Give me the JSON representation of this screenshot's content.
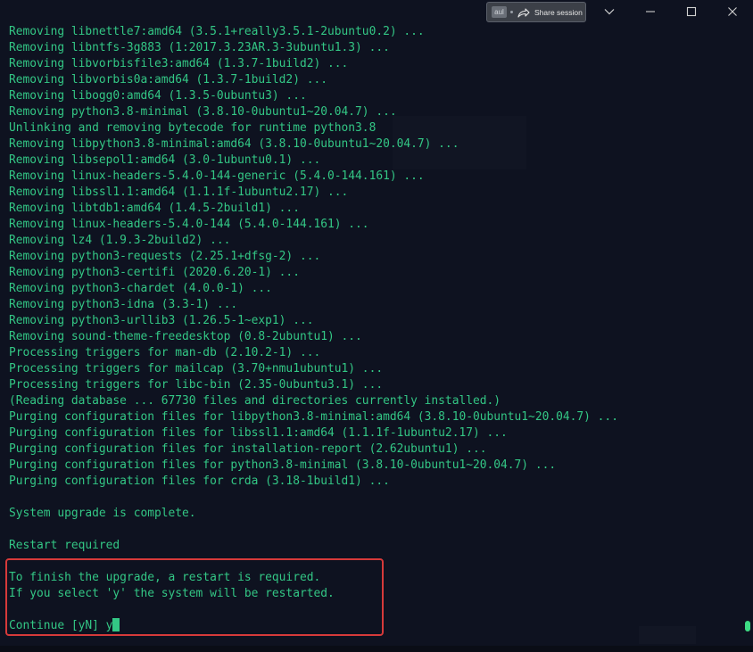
{
  "titlebar": {
    "share_badge": "aul",
    "share_label": "Share session",
    "icons": [
      "share-icon",
      "chevron-down-icon",
      "minimize-icon",
      "maximize-icon",
      "close-icon"
    ]
  },
  "colors": {
    "terminal_text": "#33c785",
    "background": "#0e1220",
    "highlight_border": "#d63a3a"
  },
  "terminal": {
    "lines": [
      "Removing libnettle7:amd64 (3.5.1+really3.5.1-2ubuntu0.2) ...",
      "Removing libntfs-3g883 (1:2017.3.23AR.3-3ubuntu1.3) ...",
      "Removing libvorbisfile3:amd64 (1.3.7-1build2) ...",
      "Removing libvorbis0a:amd64 (1.3.7-1build2) ...",
      "Removing libogg0:amd64 (1.3.5-0ubuntu3) ...",
      "Removing python3.8-minimal (3.8.10-0ubuntu1~20.04.7) ...",
      "Unlinking and removing bytecode for runtime python3.8",
      "Removing libpython3.8-minimal:amd64 (3.8.10-0ubuntu1~20.04.7) ...",
      "Removing libsepol1:amd64 (3.0-1ubuntu0.1) ...",
      "Removing linux-headers-5.4.0-144-generic (5.4.0-144.161) ...",
      "Removing libssl1.1:amd64 (1.1.1f-1ubuntu2.17) ...",
      "Removing libtdb1:amd64 (1.4.5-2build1) ...",
      "Removing linux-headers-5.4.0-144 (5.4.0-144.161) ...",
      "Removing lz4 (1.9.3-2build2) ...",
      "Removing python3-requests (2.25.1+dfsg-2) ...",
      "Removing python3-certifi (2020.6.20-1) ...",
      "Removing python3-chardet (4.0.0-1) ...",
      "Removing python3-idna (3.3-1) ...",
      "Removing python3-urllib3 (1.26.5-1~exp1) ...",
      "Removing sound-theme-freedesktop (0.8-2ubuntu1) ...",
      "Processing triggers for man-db (2.10.2-1) ...",
      "Processing triggers for mailcap (3.70+nmu1ubuntu1) ...",
      "Processing triggers for libc-bin (2.35-0ubuntu3.1) ...",
      "(Reading database ... 67730 files and directories currently installed.)",
      "Purging configuration files for libpython3.8-minimal:amd64 (3.8.10-0ubuntu1~20.04.7) ...",
      "Purging configuration files for libssl1.1:amd64 (1.1.1f-1ubuntu2.17) ...",
      "Purging configuration files for installation-report (2.62ubuntu1) ...",
      "Purging configuration files for python3.8-minimal (3.8.10-0ubuntu1~20.04.7) ...",
      "Purging configuration files for crda (3.18-1build1) ...",
      "",
      "System upgrade is complete.",
      "",
      "Restart required",
      "",
      "To finish the upgrade, a restart is required.",
      "If you select 'y' the system will be restarted.",
      ""
    ],
    "prompt": "Continue [yN] ",
    "input": "y"
  }
}
